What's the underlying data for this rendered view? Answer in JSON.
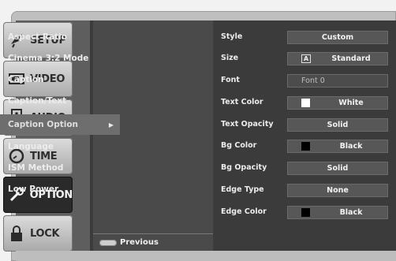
{
  "tabs": [
    {
      "label": "SETUP",
      "icon": "satellite-dish-icon",
      "active": false
    },
    {
      "label": "VIDEO",
      "icon": "monitor-icon",
      "active": false
    },
    {
      "label": "AUDIO",
      "icon": "speaker-icon",
      "active": false
    },
    {
      "label": "TIME",
      "icon": "clock-icon",
      "active": false
    },
    {
      "label": "OPTION",
      "icon": "wrench-icon",
      "active": true
    },
    {
      "label": "LOCK",
      "icon": "padlock-icon",
      "active": false
    }
  ],
  "menu": {
    "items": [
      {
        "label": "Aspect Ratio"
      },
      {
        "label": "Cinema 3:2 Mode"
      },
      {
        "label": "Caption"
      },
      {
        "label": "Caption/Text"
      },
      {
        "label": "Caption Option",
        "selected": true
      },
      {
        "label": "Language"
      },
      {
        "label": "ISM Method"
      },
      {
        "label": "Low Power"
      }
    ],
    "previous_label": "Previous"
  },
  "settings": {
    "style": {
      "label": "Style",
      "value": "Custom"
    },
    "size": {
      "label": "Size",
      "badge": "A",
      "value": "Standard"
    },
    "font": {
      "label": "Font",
      "value": "Font 0"
    },
    "text_color": {
      "label": "Text Color",
      "value": "White",
      "swatch": "#ffffff"
    },
    "text_opacity": {
      "label": "Text Opacity",
      "value": "Solid"
    },
    "bg_color": {
      "label": "Bg Color",
      "value": "Black",
      "swatch": "#000000"
    },
    "bg_opacity": {
      "label": "Bg Opacity",
      "value": "Solid"
    },
    "edge_type": {
      "label": "Edge Type",
      "value": "None"
    },
    "edge_color": {
      "label": "Edge Color",
      "value": "Black",
      "swatch": "#000000"
    }
  }
}
